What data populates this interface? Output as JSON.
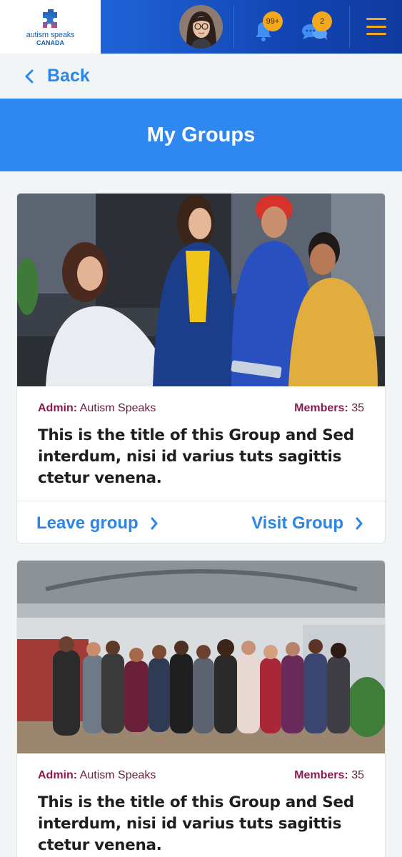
{
  "brand": {
    "logo_line1": "autism speaks",
    "logo_line2": "CANADA"
  },
  "header": {
    "notifications_count": "99+",
    "messages_count": "2"
  },
  "nav": {
    "back_label": "Back"
  },
  "page": {
    "title": "My Groups"
  },
  "groups": [
    {
      "admin_label": "Admin:",
      "admin_value": "Autism Speaks",
      "members_label": "Members:",
      "members_value": "35",
      "title": "This is the title of this Group and Sed interdum, nisi id varius tuts sagittis ctetur venena.",
      "leave_label": "Leave group",
      "visit_label": "Visit Group"
    },
    {
      "admin_label": "Admin:",
      "admin_value": "Autism Speaks",
      "members_label": "Members:",
      "members_value": "35",
      "title": "This is the title of this Group and Sed interdum, nisi id varius tuts sagittis ctetur venena."
    }
  ],
  "colors": {
    "header_blue": "#1346b4",
    "accent_blue": "#2e88ef",
    "link_blue": "#2a86e8",
    "badge_orange": "#f4a81c",
    "meta_maroon": "#8a1a4c"
  },
  "icons": [
    "puzzle-logo-icon",
    "bell-icon",
    "chat-icon",
    "hamburger-icon",
    "chevron-left-icon",
    "chevron-right-icon"
  ]
}
